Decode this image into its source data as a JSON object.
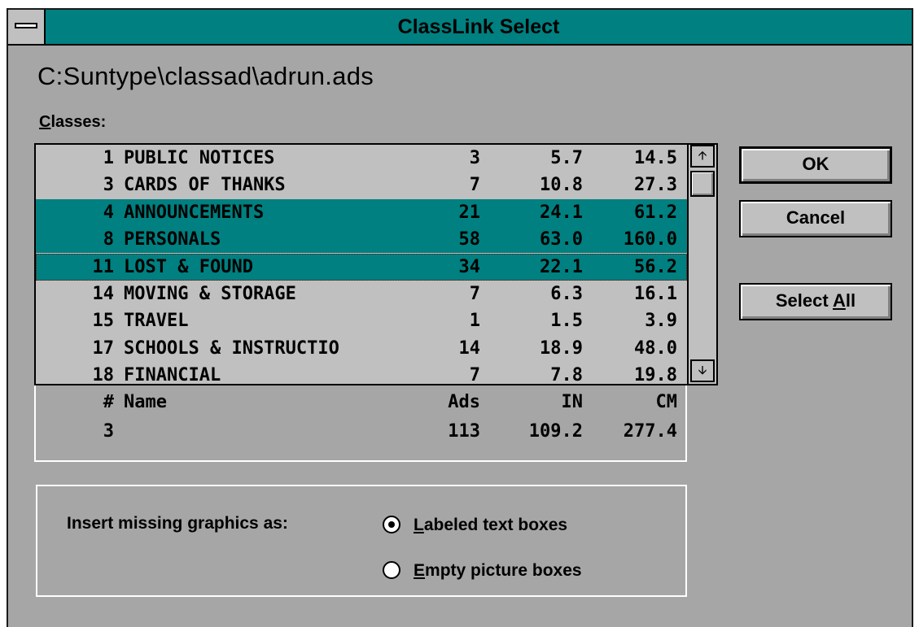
{
  "window": {
    "title": "ClassLink Select"
  },
  "path": "C:Suntype\\classad\\adrun.ads",
  "classes": {
    "label_accel": "C",
    "label_rest": "lasses:",
    "rows": [
      {
        "num": "1",
        "name": "PUBLIC NOTICES",
        "ads": "3",
        "in": "5.7",
        "cm": "14.5",
        "selected": false
      },
      {
        "num": "3",
        "name": "CARDS OF THANKS",
        "ads": "7",
        "in": "10.8",
        "cm": "27.3",
        "selected": false
      },
      {
        "num": "4",
        "name": "ANNOUNCEMENTS",
        "ads": "21",
        "in": "24.1",
        "cm": "61.2",
        "selected": true
      },
      {
        "num": "8",
        "name": "PERSONALS",
        "ads": "58",
        "in": "63.0",
        "cm": "160.0",
        "selected": true
      },
      {
        "num": "11",
        "name": "LOST & FOUND",
        "ads": "34",
        "in": "22.1",
        "cm": "56.2",
        "selected": true
      },
      {
        "num": "14",
        "name": "MOVING & STORAGE",
        "ads": "7",
        "in": "6.3",
        "cm": "16.1",
        "selected": false
      },
      {
        "num": "15",
        "name": "TRAVEL",
        "ads": "1",
        "in": "1.5",
        "cm": "3.9",
        "selected": false
      },
      {
        "num": "17",
        "name": "SCHOOLS & INSTRUCTIO",
        "ads": "14",
        "in": "18.9",
        "cm": "48.0",
        "selected": false
      },
      {
        "num": "18",
        "name": "FINANCIAL",
        "ads": "7",
        "in": "7.8",
        "cm": "19.8",
        "selected": false
      }
    ]
  },
  "totals": {
    "headers": {
      "num": "#",
      "name": "Name",
      "ads": "Ads",
      "in": "IN",
      "cm": "CM"
    },
    "values": {
      "num": "3",
      "ads": "113",
      "in": "109.2",
      "cm": "277.4"
    }
  },
  "buttons": {
    "ok": "OK",
    "cancel": "Cancel",
    "select_all_pre": "Select ",
    "select_all_accel": "A",
    "select_all_post": "ll"
  },
  "insert": {
    "label": "Insert missing graphics as:",
    "options": [
      {
        "accel": "L",
        "rest": "abeled text boxes",
        "checked": true
      },
      {
        "accel": "E",
        "rest": "mpty picture boxes",
        "checked": false
      }
    ]
  },
  "icons": {
    "scroll_up": "up-arrow-icon",
    "scroll_down": "down-arrow-icon",
    "system_menu": "system-menu-icon"
  },
  "colors": {
    "title_bar": "#008080",
    "selection": "#008080",
    "dialog_face": "#a6a6a6"
  }
}
